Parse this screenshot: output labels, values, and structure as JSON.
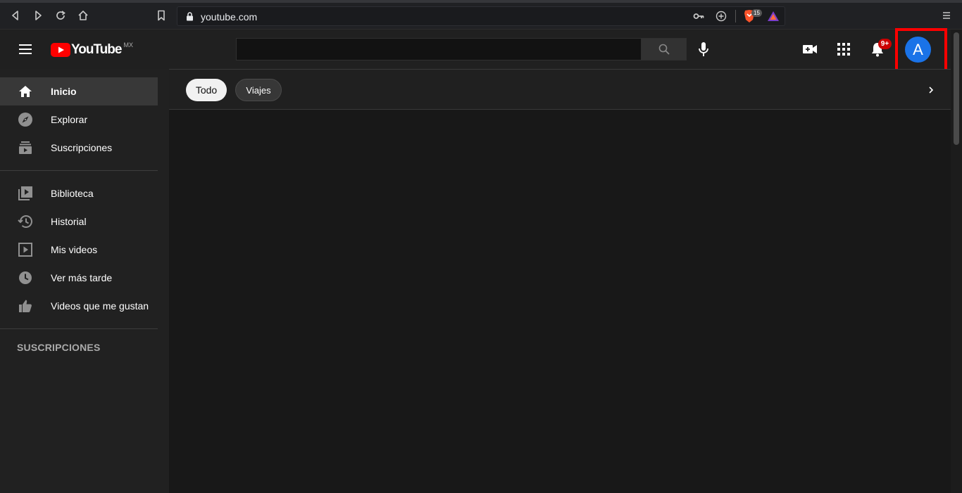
{
  "browser": {
    "url": "youtube.com",
    "extension_badge": "15"
  },
  "header": {
    "logo_text": "YouTube",
    "region": "MX",
    "search_placeholder": "",
    "notifications_badge": "9+",
    "avatar_letter": "A",
    "highlight_color": "#ff0000"
  },
  "sidebar": {
    "items": [
      {
        "label": "Inicio",
        "icon": "home-icon",
        "active": true
      },
      {
        "label": "Explorar",
        "icon": "compass-icon"
      },
      {
        "label": "Suscripciones",
        "icon": "subscriptions-icon"
      },
      {
        "label": "Biblioteca",
        "icon": "library-icon"
      },
      {
        "label": "Historial",
        "icon": "history-icon"
      },
      {
        "label": "Mis videos",
        "icon": "play-square-icon"
      },
      {
        "label": "Ver más tarde",
        "icon": "clock-icon"
      },
      {
        "label": "Videos que me gustan",
        "icon": "thumbs-up-icon"
      }
    ],
    "section_title": "SUSCRIPCIONES"
  },
  "chips": [
    {
      "label": "Todo",
      "selected": true
    },
    {
      "label": "Viajes",
      "selected": false
    }
  ]
}
